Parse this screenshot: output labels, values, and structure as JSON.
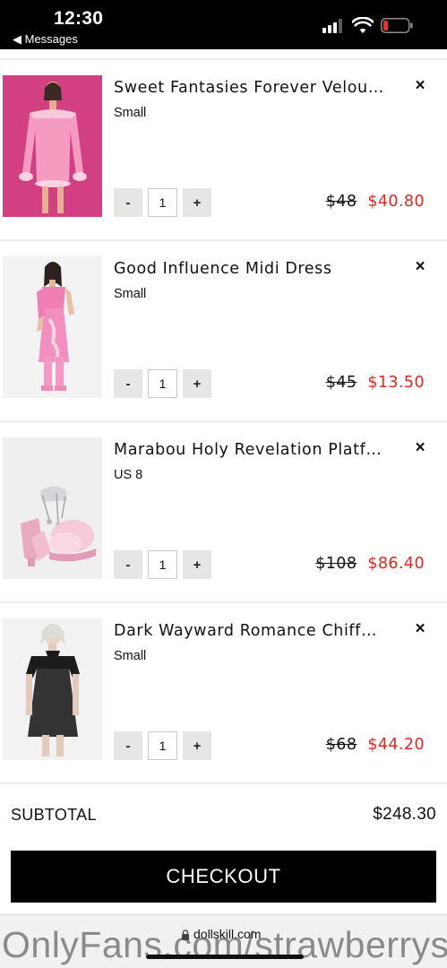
{
  "status_bar": {
    "time": "12:30",
    "back_label": "◀ Messages",
    "signal_icon": "cellular-signal-icon",
    "wifi_icon": "wifi-icon",
    "battery_icon": "battery-low-icon"
  },
  "cart": {
    "items": [
      {
        "name": "Sweet Fantasies Forever Velou…",
        "size": "Small",
        "quantity": "1",
        "decrement": "-",
        "increment": "+",
        "original_price": "$48",
        "sale_price": "$40.80",
        "remove": "×"
      },
      {
        "name": "Good Influence Midi Dress",
        "size": "Small",
        "quantity": "1",
        "decrement": "-",
        "increment": "+",
        "original_price": "$45",
        "sale_price": "$13.50",
        "remove": "×"
      },
      {
        "name": "Marabou Holy Revelation Platf…",
        "size": "US 8",
        "quantity": "1",
        "decrement": "-",
        "increment": "+",
        "original_price": "$108",
        "sale_price": "$86.40",
        "remove": "×"
      },
      {
        "name": "Dark Wayward Romance Chiff…",
        "size": "Small",
        "quantity": "1",
        "decrement": "-",
        "increment": "+",
        "original_price": "$68",
        "sale_price": "$44.20",
        "remove": "×"
      }
    ]
  },
  "summary": {
    "subtotal_label": "SUBTOTAL",
    "subtotal_value": "$248.30",
    "checkout_label": "CHECKOUT"
  },
  "browser": {
    "domain": "dollskill.com",
    "lock_icon": "lock-icon"
  },
  "watermark": "OnlyFans.com/strawberrys",
  "colors": {
    "sale": "#e0261f",
    "status_bar": "#000000",
    "checkout": "#000000",
    "qty_button": "#e6e6e4",
    "battery_low": "#e5322b"
  }
}
